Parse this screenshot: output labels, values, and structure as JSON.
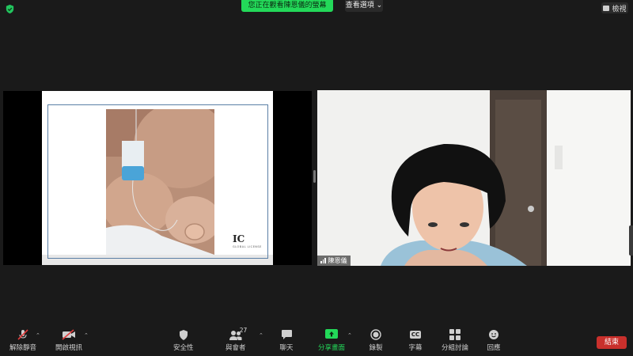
{
  "top": {
    "share_banner": "您正在觀看陳恩儀的螢幕",
    "view_options": "查看選項 ⌄",
    "view_label": "檢視",
    "security_icon": "shield-check-icon"
  },
  "shared_screen": {
    "logo_text": "IC",
    "logo_superscript": "L",
    "logo_subtext": "GLOBAL LICENSE"
  },
  "participant": {
    "name": "陳恩儀",
    "icons": {
      "signal": "signal-bars-icon"
    }
  },
  "toolbar": {
    "unmute": "解除靜音",
    "start_video": "開啟視訊",
    "security": "安全性",
    "participants": "與會者",
    "participants_count": "27",
    "chat": "聊天",
    "share_screen": "分享畫面",
    "record": "錄製",
    "captions": "字幕",
    "breakout": "分組討論",
    "reactions": "回應",
    "end": "結束",
    "captions_badge": "CC"
  },
  "colors": {
    "background": "#1a1a1a",
    "share_green": "#23d959",
    "end_red": "#c9302c",
    "mute_red": "#e03c3c"
  }
}
